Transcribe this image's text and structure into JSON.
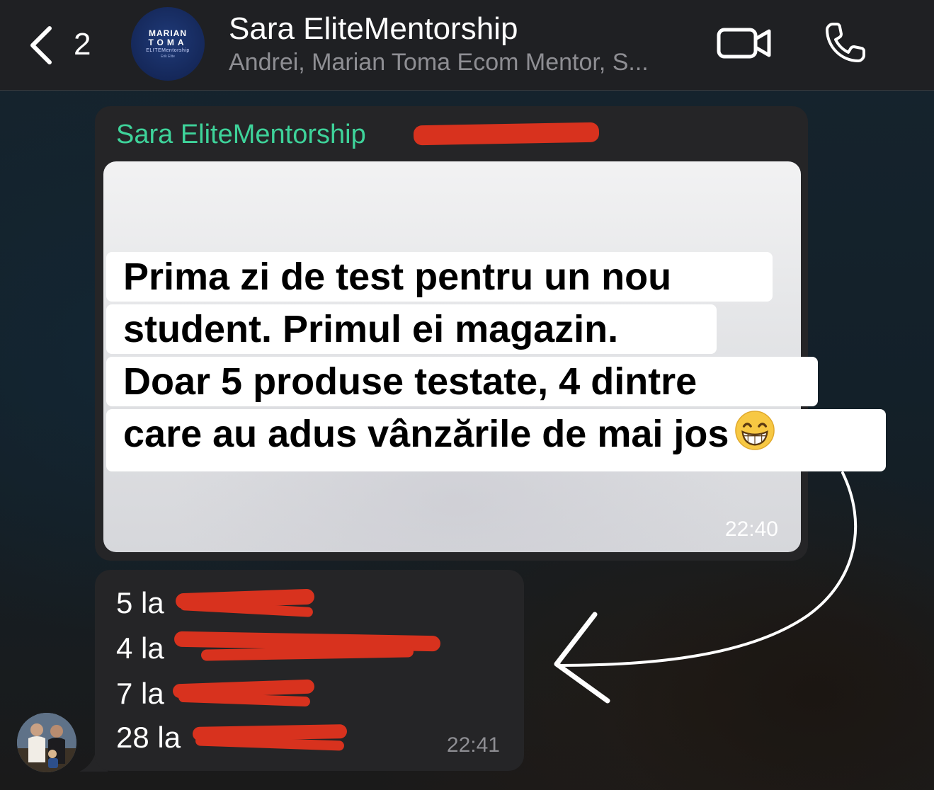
{
  "header": {
    "back_count": "2",
    "group_avatar": {
      "line1": "MARIAN",
      "line2": "TOMA",
      "line3": "ELITEMentorship",
      "line4": "Erik Elite"
    },
    "title": "Sara EliteMentorship",
    "subtitle": "Andrei, Marian Toma Ecom Mentor, S...",
    "icons": {
      "back": "chevron-left-icon",
      "video": "video-camera-icon",
      "call": "phone-icon"
    }
  },
  "messages": [
    {
      "sender": "Sara EliteMentorship",
      "sender_color": "#3ed39a",
      "image_caption": [
        "Prima zi de test pentru un nou",
        "student. Primul ei magazin.",
        "Doar 5 produse testate, 4 dintre",
        "care au adus vânzările de mai jos"
      ],
      "caption_emoji": "grinning-face-with-smiling-eyes",
      "time": "22:40"
    },
    {
      "lines": [
        "5 la",
        "4 la",
        "7 la",
        "28 la"
      ],
      "time": "22:41"
    }
  ],
  "colors": {
    "header_bg": "#1f2023",
    "bubble_bg": "#252527",
    "redaction": "#d8321e",
    "accent_green": "#3ed39a"
  }
}
